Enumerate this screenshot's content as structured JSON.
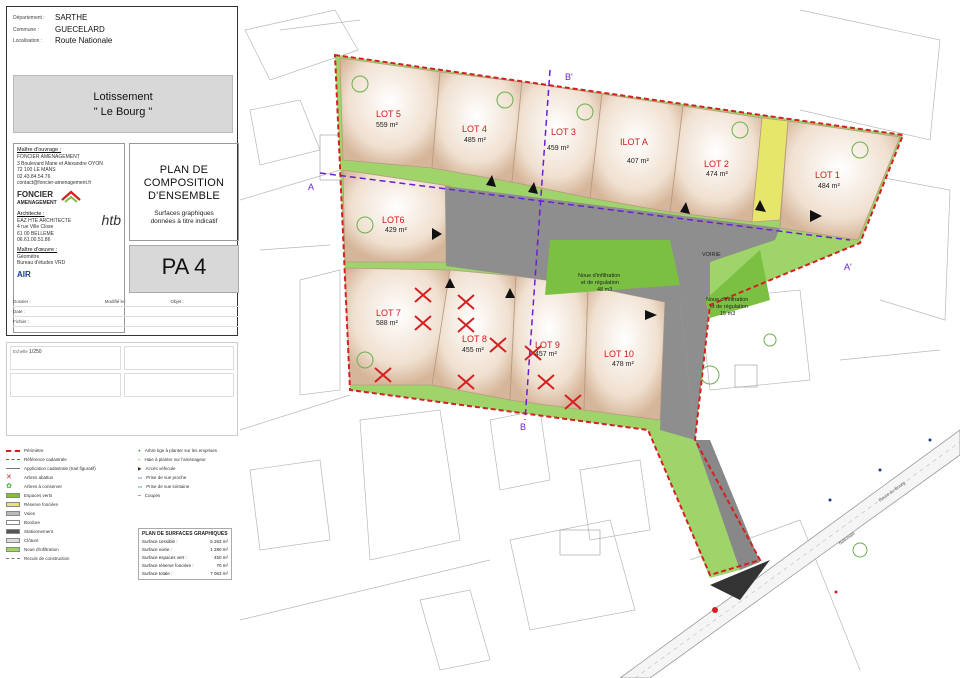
{
  "cartouche": {
    "departement_label": "Département :",
    "departement": "SARTHE",
    "commune_label": "Commune :",
    "commune": "GUECELARD",
    "localisation_label": "Localisation :",
    "localisation": "Route Nationale",
    "lot_title_1": "Lotissement",
    "lot_title_2": "\" Le Bourg \"",
    "maitre_ouvrage_label": "Maître d'ouvrage :",
    "maitre_ouvrage": "FONCIER AMENAGEMENT",
    "maitre_ouvrage_addr1": "3 Boulevard Marie et Alexandre OYON",
    "maitre_ouvrage_addr2": "72 100 LE MANS",
    "maitre_ouvrage_tel": "02.43.84.54.76",
    "maitre_ouvrage_mail": "contact@foncier-amenagement.fr",
    "logo_foncier": "FONCIER",
    "logo_amenagement": "AMENAGEMENT",
    "architecte_label": "Architecte :",
    "architecte": "EAZ HTE ARCHITECTE",
    "architecte_addr1": "4 rue Ville Close",
    "architecte_addr2": "61 00 BELLEME",
    "architecte_tel": "06.61.00.51.86",
    "maitre_oeuvre_label": "Maître d'œuvre :",
    "maitre_oeuvre_1": "Géomètre",
    "maitre_oeuvre_2": "Bureau d'études VRD",
    "logo_air": "AIR",
    "plan_title_1": "PLAN DE",
    "plan_title_2": "COMPOSITION",
    "plan_title_3": "D'ENSEMBLE",
    "plan_sub_1": "Surfaces graphiques",
    "plan_sub_2": "données à titre indicatif",
    "pa": "PA 4",
    "dossier_label": "Dossier :",
    "date_label": "Date :",
    "fichier_label": "Fichier :",
    "modifie_label": "Modifié le :",
    "objet_label": "Objet :"
  },
  "notes": {
    "scale_label": "Echelle",
    "scale": "1/250"
  },
  "legend": {
    "items": [
      "Périmètre",
      "Référence cadastrale",
      "Application cadastrale (trait figuratif)",
      "Arbres abattus",
      "Arbres à conserver",
      "Espaces verts",
      "Réserve foncière",
      "Voies",
      "Bordure",
      "Stationnement",
      "Clôture",
      "Noue d'infiltration",
      "Reculs de construction"
    ],
    "items2": [
      "Arbre tige à planter sur les emprises",
      "Haie à planter sur l'aménageur",
      "Accès véhicule",
      "Prise de vue proche",
      "Prise de vue lointaine",
      "Coupes"
    ]
  },
  "surfaces": {
    "title": "PLAN DE SURFACES GRAPHIQUES",
    "rows": [
      {
        "label": "Surface cessible :",
        "value": "5 263 m²"
      },
      {
        "label": "Surface voirie :",
        "value": "1 280 m²"
      },
      {
        "label": "Surface espaces vert :",
        "value": "450 m²"
      },
      {
        "label": "Surface réserve foncière :",
        "value": "70 m²"
      },
      {
        "label": "Surface totale :",
        "value": "7 063 m²"
      }
    ]
  },
  "lots": [
    {
      "name": "LOT 5",
      "area": "559 m²"
    },
    {
      "name": "LOT 4",
      "area": "485 m²"
    },
    {
      "name": "LOT 3",
      "area": "459 m²"
    },
    {
      "name": "ILOT A",
      "area": "407 m²"
    },
    {
      "name": "LOT 2",
      "area": "474 m²"
    },
    {
      "name": "LOT 1",
      "area": "484 m²"
    },
    {
      "name": "LOT6",
      "area": "429 m²"
    },
    {
      "name": "LOT 7",
      "area": "588 m²"
    },
    {
      "name": "LOT 8",
      "area": "455 m²"
    },
    {
      "name": "LOT 9",
      "area": "457 m²"
    },
    {
      "name": "LOT 10",
      "area": "478 m²"
    }
  ],
  "map_labels": {
    "voirie": "VOIRIE",
    "noue1_a": "Noue d'infiltration",
    "noue1_b": "et de régulation",
    "noue1_c": "48 m3",
    "noue2_a": "Noue d'infiltration",
    "noue2_b": "et de régulation",
    "noue2_c": "15 m3",
    "section_a": "A",
    "section_a2": "A'",
    "section_b": "B",
    "section_b2": "B'",
    "rue": "Nationale",
    "rue2": "Route du Bourg"
  },
  "colors": {
    "perimeter": "#d42020",
    "lot_fill": "#f3e7da",
    "road": "#8e8e8e",
    "green": "#7bc043",
    "section": "#6a1fd0",
    "reserve": "#e6e66a"
  }
}
